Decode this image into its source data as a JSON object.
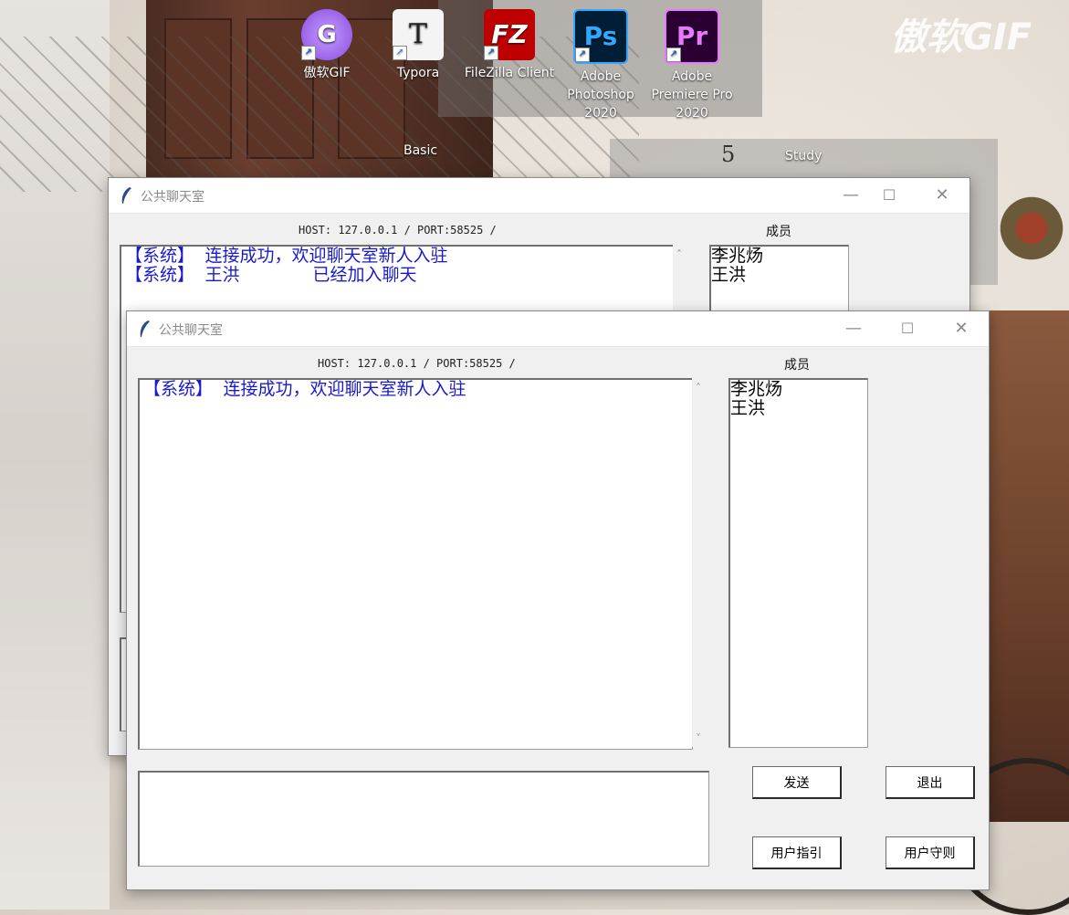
{
  "desktop": {
    "icons": [
      {
        "label": "傲软GIF",
        "icon": "aoruan-gif-icon",
        "color": "#a066e8"
      },
      {
        "label": "Typora",
        "icon": "typora-icon",
        "color": "#f4f4f4"
      },
      {
        "label": "FileZilla Client",
        "icon": "filezilla-icon",
        "color": "#bf0000"
      },
      {
        "label": "Adobe Photoshop 2020",
        "icon": "photoshop-icon",
        "color": "#001e36"
      },
      {
        "label": "Adobe Premiere Pro 2020",
        "icon": "premiere-icon",
        "color": "#2a0033"
      }
    ],
    "icon_glyphs": [
      "G",
      "T",
      "FZ",
      "Ps",
      "Pr"
    ],
    "basic_label": "Basic",
    "study_label": "Study",
    "five_label": "5",
    "watermark": "傲软GIF"
  },
  "back_window": {
    "title": "公共聊天室",
    "host": "HOST: 127.0.0.1 / PORT:58525 /",
    "members_label": "成员",
    "messages": [
      "【系统】 连接成功，欢迎聊天室新人入驻",
      "【系统】 王洪       已经加入聊天"
    ],
    "members": [
      "李兆炀",
      "王洪"
    ],
    "minimize": "—",
    "maximize": "☐",
    "close": "✕"
  },
  "front_window": {
    "title": "公共聊天室",
    "host": "HOST: 127.0.0.1 / PORT:58525 /",
    "members_label": "成员",
    "messages": [
      "【系统】 连接成功，欢迎聊天室新人入驻"
    ],
    "members": [
      "李兆炀",
      "王洪"
    ],
    "input_value": "",
    "buttons": {
      "send": "发送",
      "exit": "退出",
      "guide": "用户指引",
      "rules": "用户守则"
    },
    "minimize": "—",
    "maximize": "☐",
    "close": "✕"
  },
  "colors": {
    "system_message": "#1a1acc",
    "title_text": "#8a8a8a"
  }
}
